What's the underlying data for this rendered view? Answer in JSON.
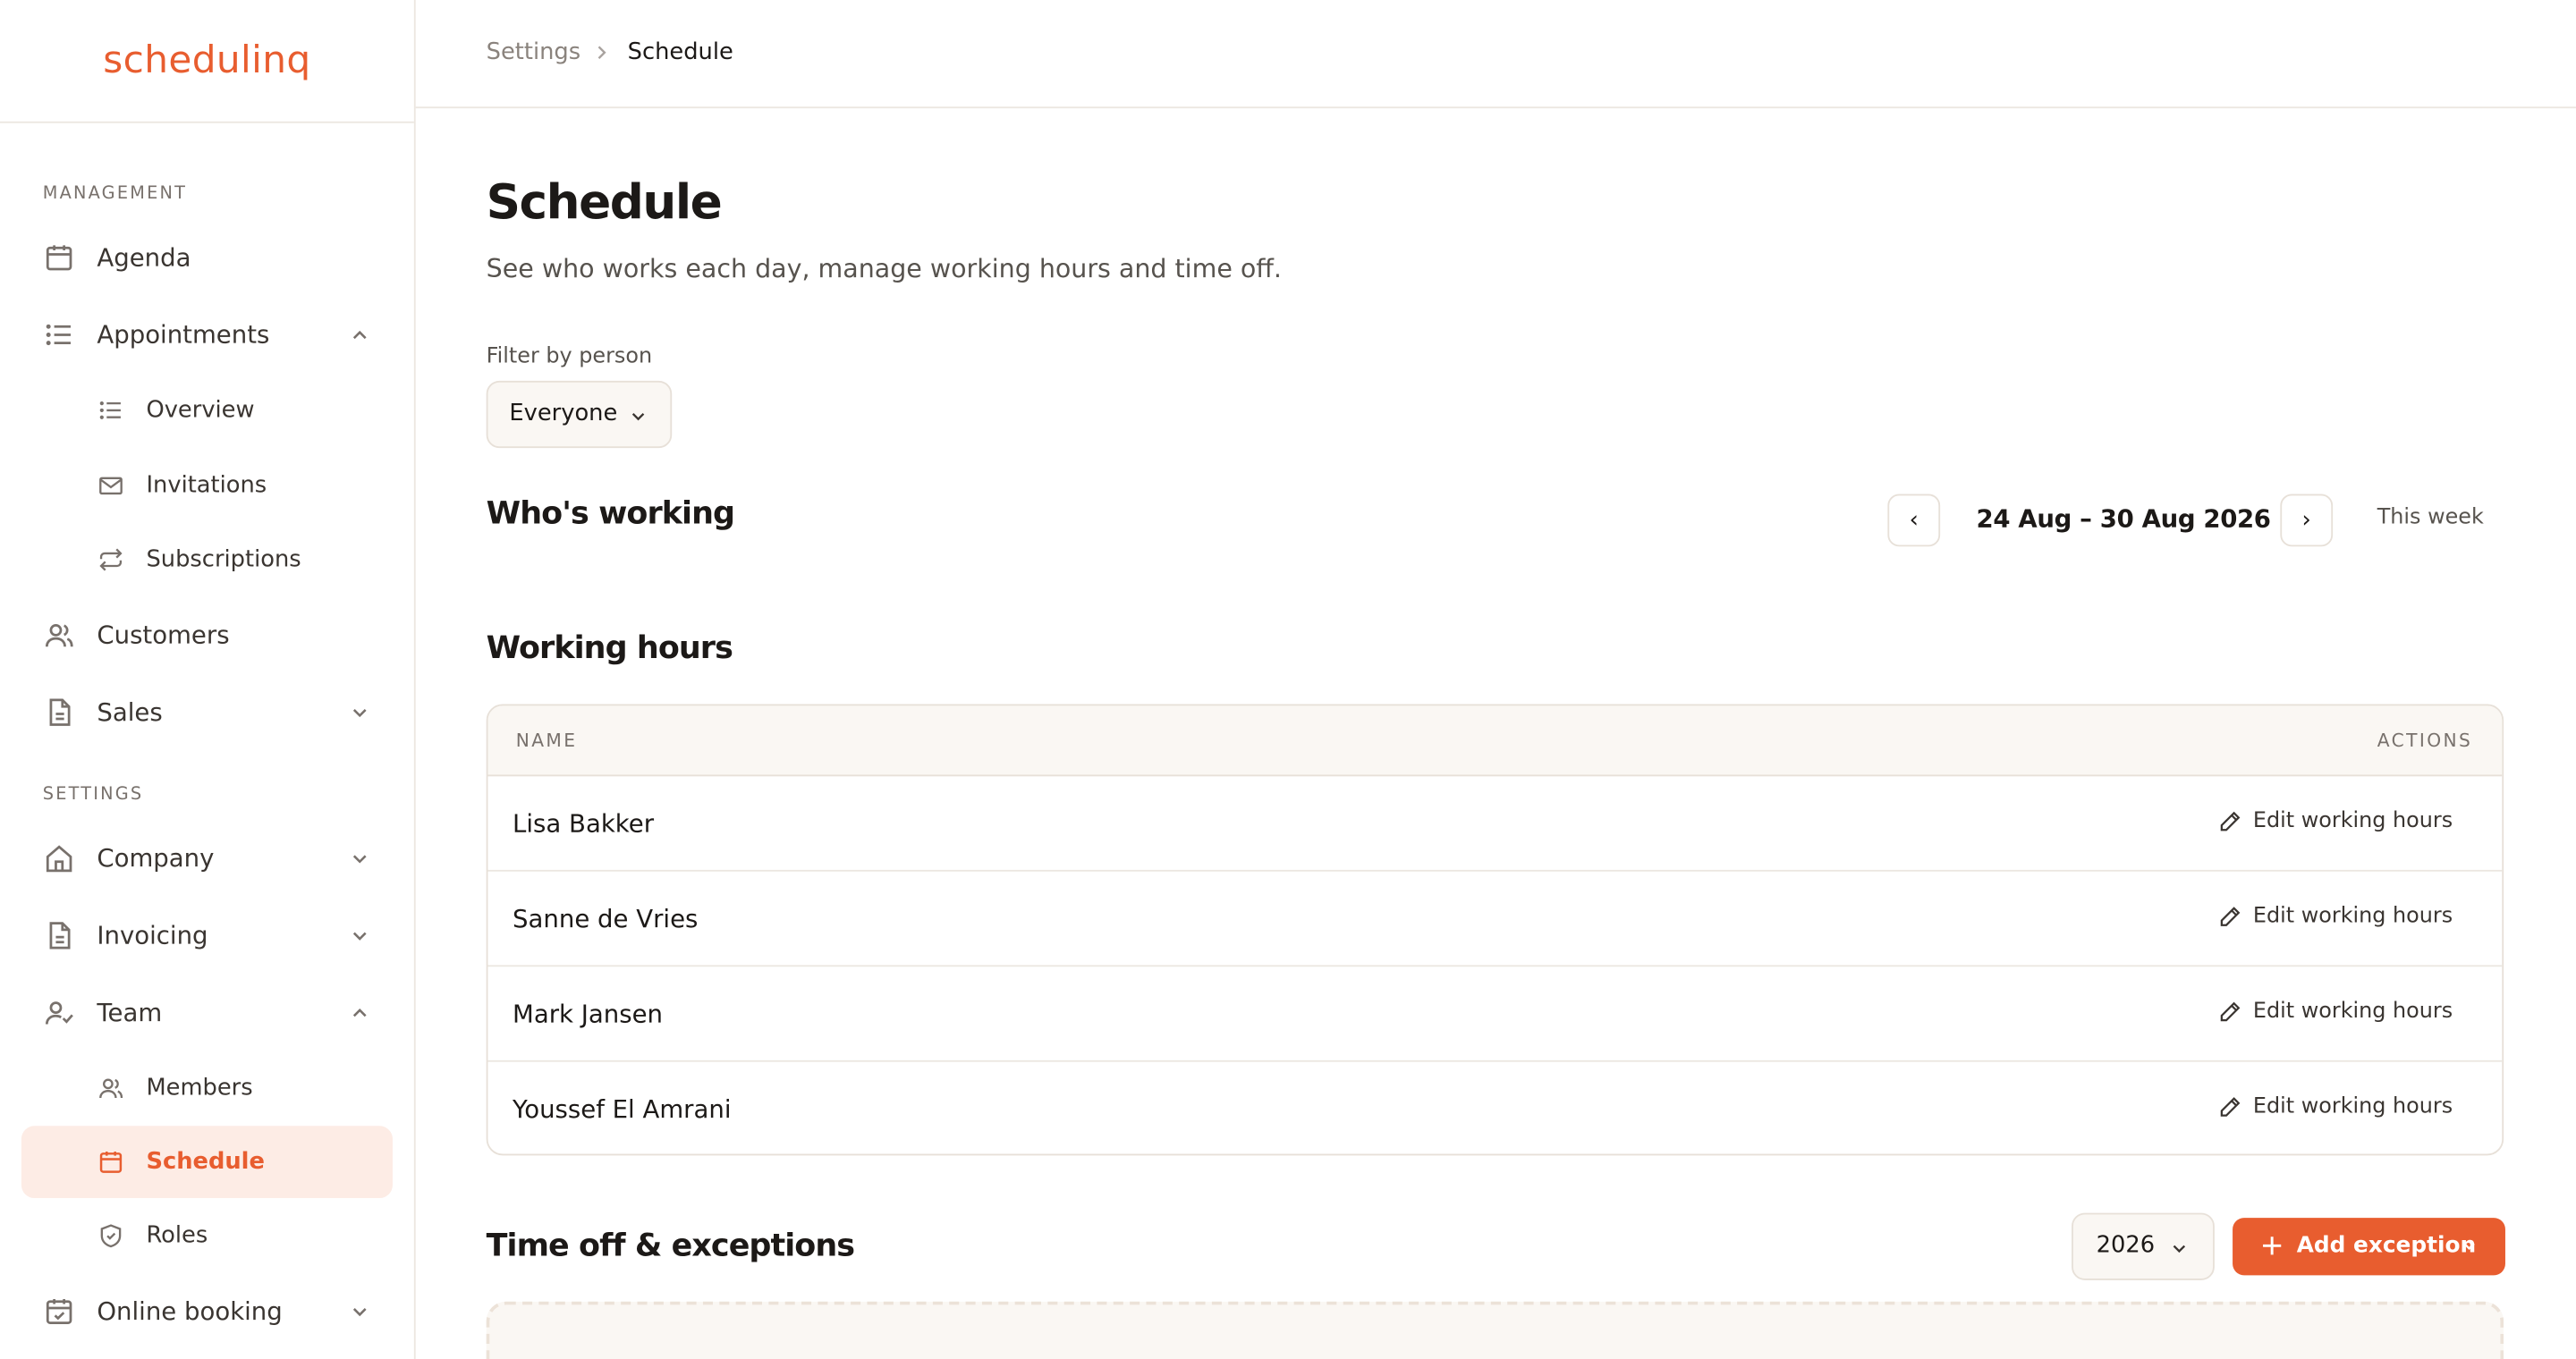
{
  "brand": {
    "logo_text": "schedulinq",
    "accent": "#e85d2f"
  },
  "sidebar": {
    "sections": [
      {
        "label": "MANAGEMENT"
      },
      {
        "label": "SETTINGS"
      }
    ],
    "items": [
      {
        "label": "Agenda",
        "icon": "calendar-icon"
      },
      {
        "label": "Appointments",
        "icon": "list-icon",
        "expanded": true
      },
      {
        "label": "Overview",
        "icon": "list-icon",
        "sub": true
      },
      {
        "label": "Invitations",
        "icon": "mail-icon",
        "sub": true
      },
      {
        "label": "Subscriptions",
        "icon": "repeat-icon",
        "sub": true
      },
      {
        "label": "Customers",
        "icon": "users-icon"
      },
      {
        "label": "Sales",
        "icon": "document-icon",
        "expanded": false
      },
      {
        "label": "Company",
        "icon": "home-icon",
        "expanded": false
      },
      {
        "label": "Invoicing",
        "icon": "document-icon",
        "expanded": false
      },
      {
        "label": "Team",
        "icon": "user-check-icon",
        "expanded": true
      },
      {
        "label": "Members",
        "icon": "users-icon",
        "sub": true
      },
      {
        "label": "Schedule",
        "icon": "calendar-icon",
        "sub": true,
        "active": true
      },
      {
        "label": "Roles",
        "icon": "shield-icon",
        "sub": true
      },
      {
        "label": "Online booking",
        "icon": "calendar-check-icon",
        "expanded": false
      }
    ]
  },
  "breadcrumb": {
    "parent": "Settings",
    "current": "Schedule"
  },
  "page": {
    "title": "Schedule",
    "subtitle": "See who works each day, manage working hours and time off.",
    "filter_label": "Filter by person",
    "filter_value": "Everyone"
  },
  "whos_working": {
    "title": "Who's working",
    "prev": "‹",
    "next": "›",
    "range": "24 Aug – 30 Aug 2026",
    "this_week": "This week"
  },
  "working_hours": {
    "title": "Working hours",
    "columns": {
      "name": "NAME",
      "actions": "ACTIONS"
    },
    "rows": [
      {
        "name": "Lisa Bakker",
        "action": "Edit working hours"
      },
      {
        "name": "Sanne de Vries",
        "action": "Edit working hours"
      },
      {
        "name": "Mark Jansen",
        "action": "Edit working hours"
      },
      {
        "name": "Youssef El Amrani",
        "action": "Edit working hours"
      }
    ]
  },
  "time_off": {
    "title": "Time off & exceptions",
    "year": "2026",
    "add_label": "Add exception"
  }
}
